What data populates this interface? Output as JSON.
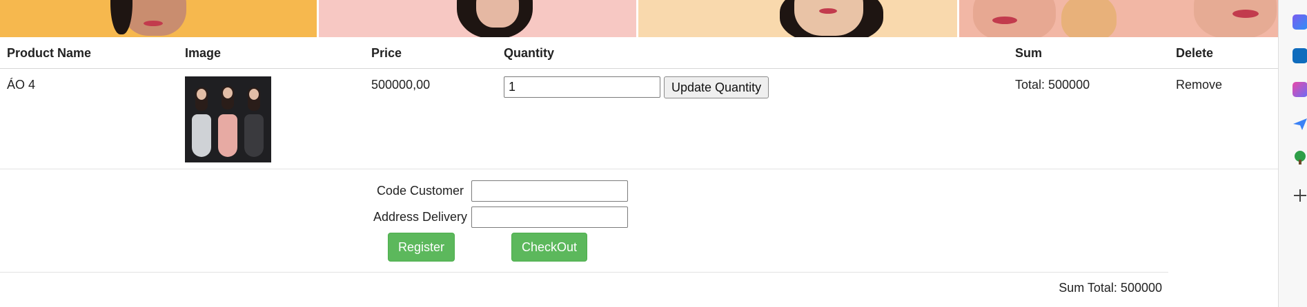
{
  "table": {
    "headers": {
      "product_name": "Product Name",
      "image": "Image",
      "price": "Price",
      "quantity": "Quantity",
      "sum": "Sum",
      "delete": "Delete"
    },
    "rows": [
      {
        "product_name": "ÁO 4",
        "price": "500000,00",
        "quantity": "1",
        "update_label": "Update Quantity",
        "sum": "Total: 500000",
        "remove_label": "Remove"
      }
    ]
  },
  "form": {
    "code_customer_label": "Code Customer",
    "code_customer_value": "",
    "address_delivery_label": "Address Delivery",
    "address_delivery_value": "",
    "register_label": "Register",
    "checkout_label": "CheckOut"
  },
  "summary": {
    "sum_total": "Sum Total: 500000"
  },
  "sidebar_icons": [
    "copilot-icon",
    "outlook-icon",
    "designer-icon",
    "send-icon",
    "tree-icon",
    "plus-icon"
  ],
  "colors": {
    "accent_green": "#5cb85c",
    "banner_1": "#f6b84e",
    "banner_2": "#f7c8c3",
    "banner_3": "#f9d9ad",
    "banner_4": "#f2b7a5"
  }
}
